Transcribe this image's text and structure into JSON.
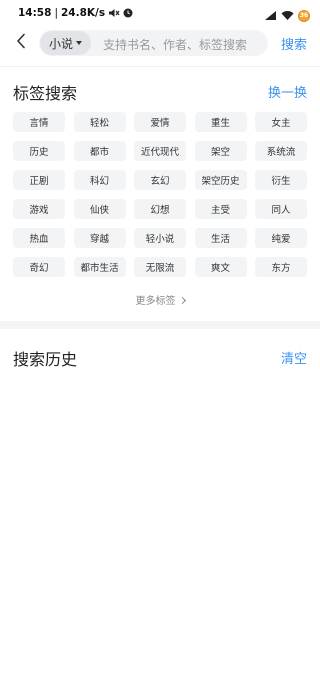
{
  "status_bar": {
    "time": "14:58",
    "speed": "24.8K/s",
    "battery": "36",
    "accent": "#f4a430"
  },
  "search": {
    "category": "小说",
    "placeholder": "支持书名、作者、标签搜索",
    "button": "搜索"
  },
  "tags_section": {
    "title": "标签搜索",
    "shuffle": "换一换",
    "rows": [
      [
        "言情",
        "轻松",
        "爱情",
        "重生",
        "女主"
      ],
      [
        "历史",
        "都市",
        "近代现代",
        "架空",
        "系统流"
      ],
      [
        "正剧",
        "科幻",
        "玄幻",
        "架空历史",
        "衍生"
      ],
      [
        "游戏",
        "仙侠",
        "幻想",
        "主受",
        "同人"
      ],
      [
        "热血",
        "穿越",
        "轻小说",
        "生活",
        "纯爱"
      ],
      [
        "奇幻",
        "都市生活",
        "无限流",
        "爽文",
        "东方"
      ]
    ],
    "more": "更多标签"
  },
  "history_section": {
    "title": "搜索历史",
    "clear": "清空"
  },
  "colors": {
    "accent_blue": "#3a93f0",
    "tag_bg": "#f3f4f6"
  }
}
